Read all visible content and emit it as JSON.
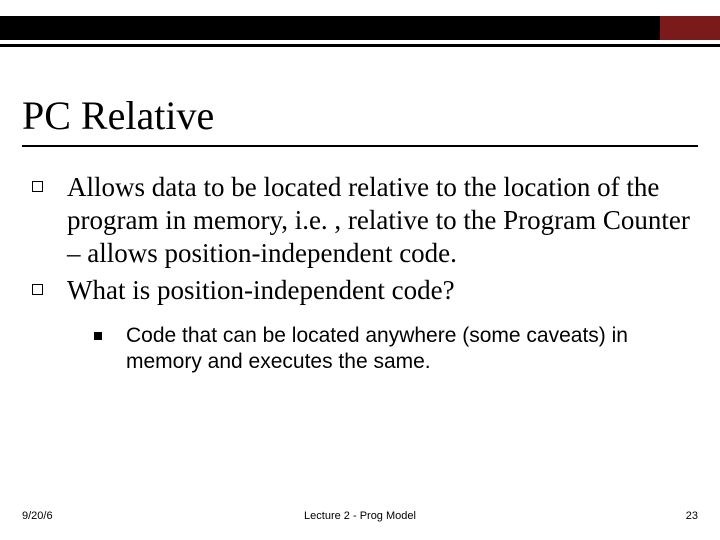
{
  "colors": {
    "accent": "#7b1a1a"
  },
  "title": "PC Relative",
  "bullets": [
    "Allows data to be located relative to the location of the program in memory, i.e. , relative to the Program Counter – allows position-independent code.",
    "What is position-independent code?"
  ],
  "sub_bullets": [
    "Code that can be located anywhere (some caveats) in memory and executes the same."
  ],
  "footer": {
    "date": "9/20/6",
    "center": "Lecture 2 - Prog Model",
    "page": "23"
  }
}
